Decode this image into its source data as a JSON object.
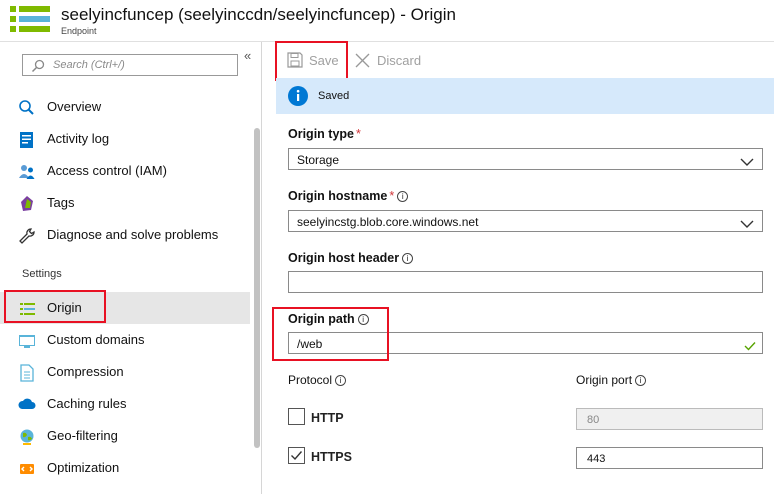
{
  "header": {
    "title": "seelyincfuncep (seelyinccdn/seelyincfuncep) - Origin",
    "subtitle": "Endpoint"
  },
  "sidebar": {
    "search_placeholder": "Search (Ctrl+/)",
    "collapse_glyph": "«",
    "items": [
      {
        "label": "Overview",
        "icon": "overview-icon"
      },
      {
        "label": "Activity log",
        "icon": "activity-log-icon"
      },
      {
        "label": "Access control (IAM)",
        "icon": "access-control-icon"
      },
      {
        "label": "Tags",
        "icon": "tag-icon"
      },
      {
        "label": "Diagnose and solve problems",
        "icon": "wrench-icon"
      }
    ],
    "settings_title": "Settings",
    "settings_items": [
      {
        "label": "Origin",
        "icon": "origin-icon",
        "selected": true
      },
      {
        "label": "Custom domains",
        "icon": "custom-domains-icon"
      },
      {
        "label": "Compression",
        "icon": "compression-icon"
      },
      {
        "label": "Caching rules",
        "icon": "caching-rules-icon"
      },
      {
        "label": "Geo-filtering",
        "icon": "globe-icon"
      },
      {
        "label": "Optimization",
        "icon": "optimization-icon"
      }
    ]
  },
  "toolbar": {
    "save_label": "Save",
    "discard_label": "Discard"
  },
  "notice": {
    "text": "Saved"
  },
  "form": {
    "origin_type_label": "Origin type",
    "origin_type_value": "Storage",
    "origin_hostname_label": "Origin hostname",
    "origin_hostname_value": "seelyincstg.blob.core.windows.net",
    "origin_host_header_label": "Origin host header",
    "origin_host_header_value": "",
    "origin_path_label": "Origin path",
    "origin_path_value": "/web",
    "protocol_label": "Protocol",
    "origin_port_label": "Origin port",
    "http_label": "HTTP",
    "http_checked": false,
    "http_port": "80",
    "https_label": "HTTPS",
    "https_checked": true,
    "https_port": "443",
    "required_mark": "*",
    "info_glyph": "i"
  },
  "colors": {
    "accent": "#0078d4",
    "highlight_border": "#e81123",
    "notice_bg": "#d6e9fb",
    "selected_bg": "#e6e6e6",
    "valid_check": "#57a300"
  }
}
